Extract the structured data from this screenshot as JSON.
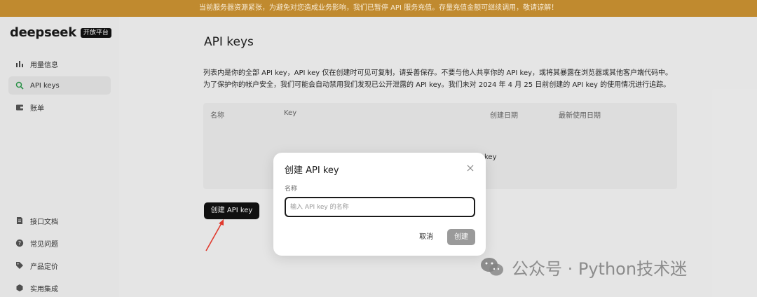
{
  "banner": {
    "text": "当前服务器资源紧张，为避免对您造成业务影响，我们已暂停 API 服务充值。存量充值金额可继续调用，敬请谅解！"
  },
  "brand": {
    "logo_text": "deepseek",
    "badge": "开放平台"
  },
  "sidebar": {
    "items": [
      {
        "label": "用量信息",
        "icon": "bar-chart-icon"
      },
      {
        "label": "API keys",
        "icon": "search-icon",
        "active": true
      },
      {
        "label": "账单",
        "icon": "wallet-icon"
      }
    ],
    "bottom_items": [
      {
        "label": "接口文档",
        "icon": "document-icon"
      },
      {
        "label": "常见问题",
        "icon": "question-icon"
      },
      {
        "label": "产品定价",
        "icon": "tag-icon"
      },
      {
        "label": "实用集成",
        "icon": "cube-icon"
      }
    ]
  },
  "main": {
    "title": "API keys",
    "desc_line1": "列表内是你的全部 API key，API key 仅在创建时可见可复制，请妥善保存。不要与他人共享你的 API key，或将其暴露在浏览器或其他客户端代码中。",
    "desc_line2": "为了保护你的帐户安全，我们可能会自动禁用我们发现已公开泄露的 API key。我们未对 2024 年 4 月 25 日前创建的 API key 的使用情况进行追踪。",
    "table": {
      "columns": [
        "名称",
        "Key",
        "创建日期",
        "最新使用日期"
      ],
      "empty_text": "key"
    },
    "create_button": "创建 API key"
  },
  "modal": {
    "title": "创建 API key",
    "field_label": "名称",
    "input_placeholder": "输入 API key 的名称",
    "input_value": "",
    "cancel": "取消",
    "confirm": "创建"
  },
  "watermark": {
    "text": "公众号 · Python技术迷",
    "icon": "wechat-icon"
  },
  "colors": {
    "banner": "#c08a2f",
    "primary_button": "#111111",
    "disabled_button": "#9a9a9a",
    "annotation_arrow": "#e03a2e"
  }
}
